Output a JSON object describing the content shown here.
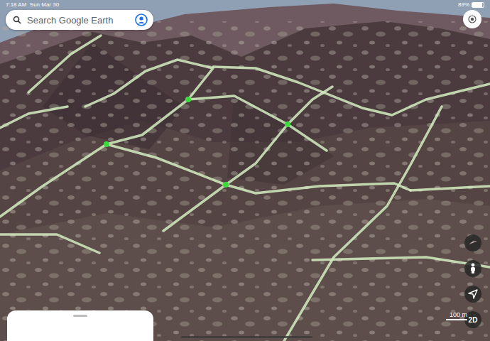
{
  "status_bar": {
    "time": "7:18 AM",
    "date": "Sun Mar 30",
    "battery": "89%",
    "battery_level": 0.89
  },
  "search": {
    "placeholder": "Search Google Earth"
  },
  "view_toggle": {
    "label": "2D"
  },
  "scale": {
    "label": "100 m"
  },
  "bottom_sheet": {
    "expanded": false
  }
}
